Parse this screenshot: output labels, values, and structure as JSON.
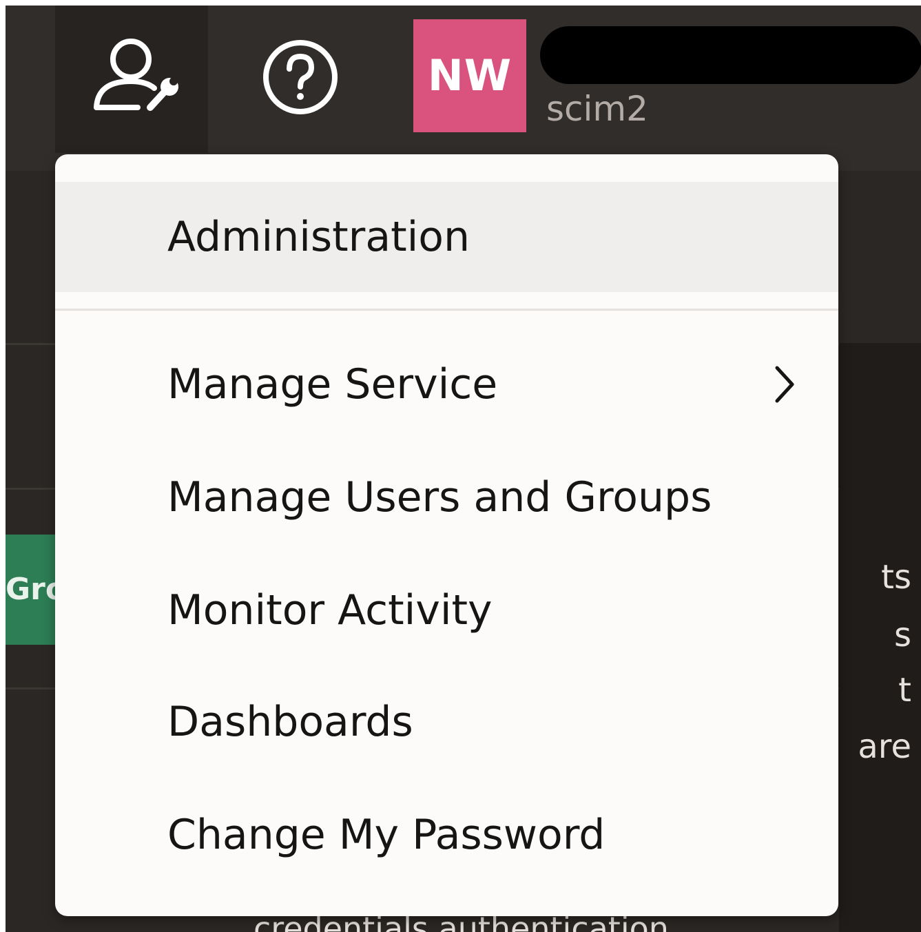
{
  "header": {
    "admin_icon": "user-wrench-icon",
    "help_icon": "help-circle-icon",
    "avatar_initials": "NW",
    "tenant": "scim2"
  },
  "menu": {
    "items": [
      {
        "label": "Administration",
        "active": true
      },
      {
        "label": "Manage Service",
        "has_submenu": true
      },
      {
        "label": "Manage Users and Groups"
      },
      {
        "label": "Monitor Activity"
      },
      {
        "label": "Dashboards"
      },
      {
        "label": "Change My Password"
      }
    ]
  },
  "background": {
    "green_button_text": "Gro",
    "right_fragments": [
      "ts",
      "s",
      "t",
      "are"
    ],
    "bottom_fragment": "credentials authentication."
  },
  "colors": {
    "header_bg": "#312d2a",
    "avatar_bg": "#d9537e",
    "menu_bg": "#fcfbfa",
    "menu_active_bg": "#efeeed",
    "accent_green": "#2d7d55"
  }
}
